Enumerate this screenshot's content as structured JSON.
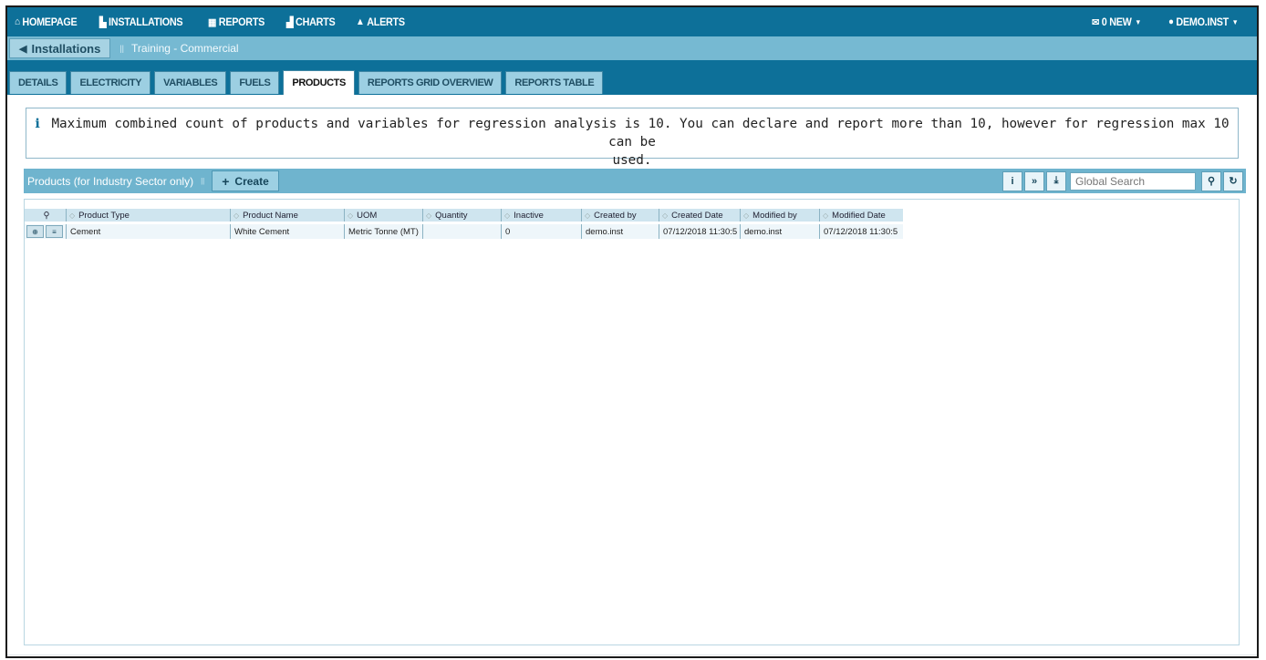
{
  "nav": {
    "items": [
      {
        "icon": "home-icon",
        "glyph": "⌂",
        "label": "HOMEPAGE"
      },
      {
        "icon": "installations-icon",
        "glyph": "▙",
        "label": "INSTALLATIONS"
      },
      {
        "icon": "reports-icon",
        "glyph": "▦",
        "label": "REPORTS"
      },
      {
        "icon": "charts-icon",
        "glyph": "▟",
        "label": "CHARTS"
      },
      {
        "icon": "alert-icon",
        "glyph": "▲",
        "label": "ALERTS"
      }
    ],
    "messages_label": "0 NEW",
    "user_label": "DEMO.INST"
  },
  "breadcrumb": {
    "back_label": "Installations",
    "current": "Training - Commercial"
  },
  "tabs": [
    "DETAILS",
    "ELECTRICITY",
    "VARIABLES",
    "FUELS",
    "PRODUCTS",
    "REPORTS GRID OVERVIEW",
    "REPORTS TABLE"
  ],
  "active_tab": "PRODUCTS",
  "info": {
    "line1": "Maximum combined count of products and variables for regression analysis is 10. You can declare and report more than 10, however for regression max 10 can be",
    "line2": "used."
  },
  "toolbar": {
    "title": "Products (for Industry Sector only)",
    "create_label": "Create",
    "search_placeholder": "Global Search"
  },
  "grid": {
    "columns": [
      "Product Type",
      "Product Name",
      "UOM",
      "Quantity",
      "Inactive",
      "Created by",
      "Created Date",
      "Modified by",
      "Modified Date"
    ],
    "rows": [
      {
        "product_type": "Cement",
        "product_name": "White Cement",
        "uom": "Metric Tonne (MT)",
        "quantity": "",
        "inactive": "0",
        "created_by": "demo.inst",
        "created_date": "07/12/2018 11:30:5",
        "modified_by": "demo.inst",
        "modified_date": "07/12/2018 11:30:5"
      }
    ]
  },
  "colors": {
    "nav_bg": "#0d7099",
    "crumb_bg": "#76b9d2",
    "toolbar_bg": "#6fb4ce",
    "tab_bg": "#9ccfe2"
  }
}
